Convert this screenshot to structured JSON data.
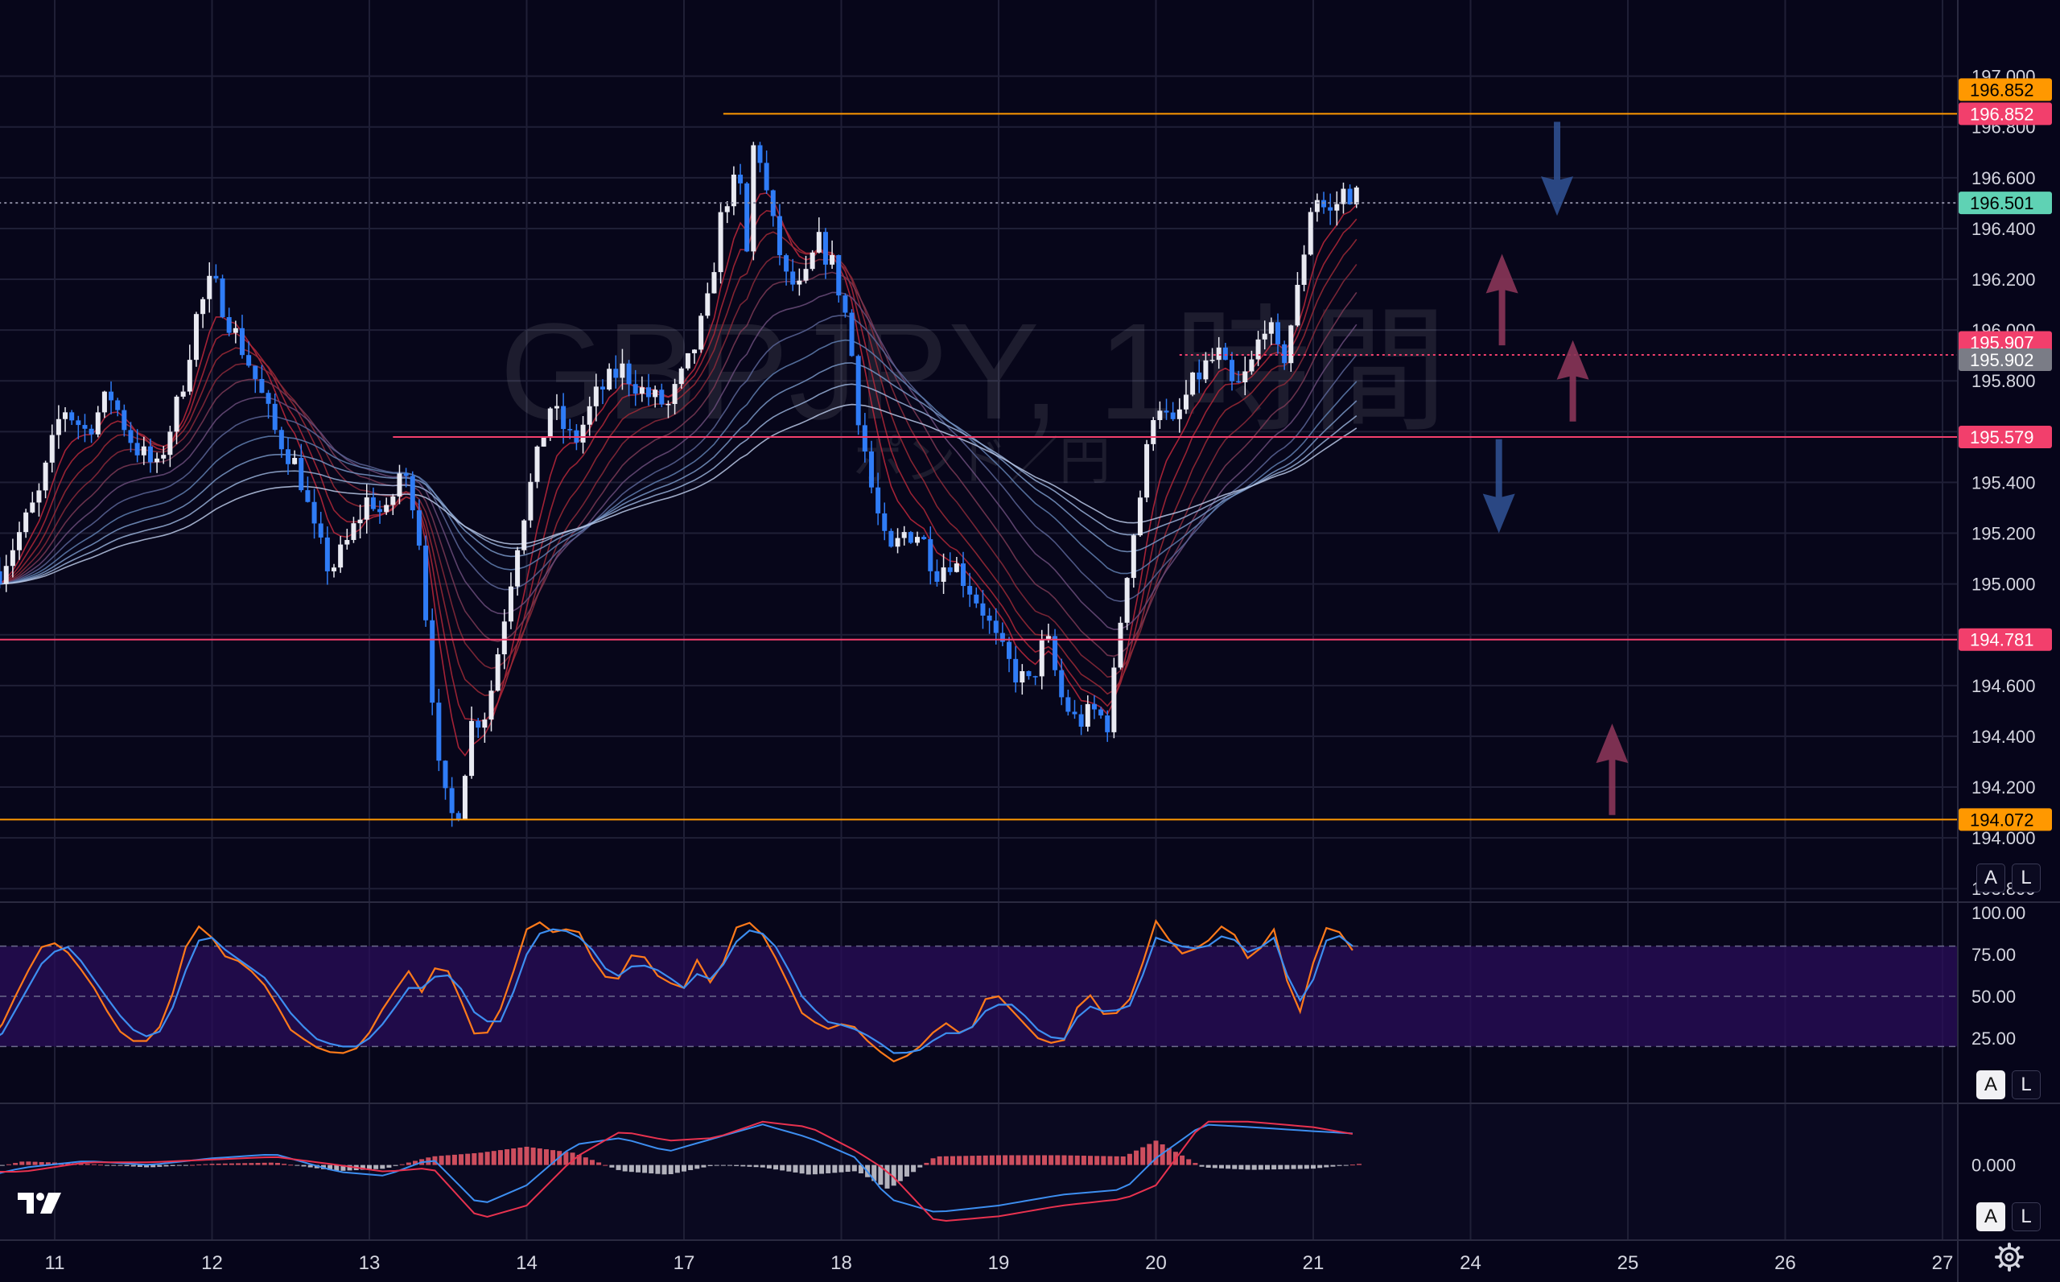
{
  "chart_data": {
    "type": "candlestick",
    "symbol": "GBPJPY, 1時間",
    "symbol_subtitle": "ポンド／円",
    "x_tick_labels": [
      "11",
      "12",
      "13",
      "14",
      "17",
      "18",
      "19",
      "20",
      "21",
      "24",
      "25",
      "26",
      "27"
    ],
    "price_axis": {
      "range": [
        193.75,
        197.3
      ],
      "tick_labels": [
        "197.000",
        "196.800",
        "196.600",
        "196.400",
        "196.200",
        "196.000",
        "195.800",
        "195.600",
        "195.400",
        "195.200",
        "195.000",
        "194.800",
        "194.600",
        "194.400",
        "194.200",
        "194.000",
        "193.800"
      ]
    },
    "price_tags": [
      {
        "label": "196.852",
        "price": 196.852,
        "color": "#ff9800",
        "text_color": "#000000"
      },
      {
        "label": "196.852",
        "price": 196.852,
        "color": "#f23f6c",
        "text_color": "#ffffff"
      },
      {
        "label": "196.501",
        "price": 196.501,
        "color": "#5fd2b4",
        "text_color": "#000000"
      },
      {
        "label": "195.907",
        "price": 195.907,
        "color": "#f23f6c",
        "text_color": "#ffffff"
      },
      {
        "label": "195.902",
        "price": 195.902,
        "color": "#7a7c86",
        "text_color": "#ffffff"
      },
      {
        "label": "195.579",
        "price": 195.579,
        "color": "#f23f6c",
        "text_color": "#ffffff"
      },
      {
        "label": "194.781",
        "price": 194.781,
        "color": "#f23f6c",
        "text_color": "#ffffff"
      },
      {
        "label": "194.072",
        "price": 194.072,
        "color": "#ff9800",
        "text_color": "#000000"
      }
    ],
    "horizontal_lines": [
      {
        "price": 196.852,
        "color": "#ff9800",
        "from_day": 4.25
      },
      {
        "price": 195.902,
        "color": "#f23f6c",
        "from_day": 7.15,
        "dotted": true
      },
      {
        "price": 195.579,
        "color": "#f23f6c",
        "from_day": 2.15
      },
      {
        "price": 194.781,
        "color": "#f23f6c",
        "from_day": -0.5
      },
      {
        "price": 194.072,
        "color": "#ff9800",
        "from_day": -0.5
      },
      {
        "price": 196.501,
        "color": "#8a8aa0",
        "from_day": -0.5,
        "dotted": true
      }
    ],
    "arrows": [
      {
        "direction": "down",
        "day": 9.55,
        "price_from": 196.82,
        "price_to": 196.45,
        "color": "#2f4f8f"
      },
      {
        "direction": "up",
        "day": 9.2,
        "price_from": 195.94,
        "price_to": 196.3,
        "color": "#8a3558"
      },
      {
        "direction": "up",
        "day": 9.65,
        "price_from": 195.64,
        "price_to": 195.96,
        "color": "#8a3558"
      },
      {
        "direction": "down",
        "day": 9.18,
        "price_from": 195.57,
        "price_to": 195.2,
        "color": "#2f4f8f"
      },
      {
        "direction": "up",
        "day": 9.9,
        "price_from": 194.09,
        "price_to": 194.45,
        "color": "#8a3558"
      }
    ],
    "price_anchors": [
      [
        -0.35,
        195.05
      ],
      [
        -0.1,
        195.35
      ],
      [
        0.05,
        195.7
      ],
      [
        0.2,
        195.6
      ],
      [
        0.35,
        195.75
      ],
      [
        0.5,
        195.55
      ],
      [
        0.65,
        195.45
      ],
      [
        0.8,
        195.75
      ],
      [
        0.9,
        196.05
      ],
      [
        1.0,
        196.2
      ],
      [
        1.1,
        196.05
      ],
      [
        1.25,
        195.85
      ],
      [
        1.4,
        195.6
      ],
      [
        1.55,
        195.45
      ],
      [
        1.65,
        195.2
      ],
      [
        1.75,
        195.05
      ],
      [
        1.85,
        195.15
      ],
      [
        2.0,
        195.35
      ],
      [
        2.1,
        195.25
      ],
      [
        2.2,
        195.45
      ],
      [
        2.3,
        195.3
      ],
      [
        2.37,
        194.8
      ],
      [
        2.45,
        194.2
      ],
      [
        2.55,
        194.05
      ],
      [
        2.65,
        194.45
      ],
      [
        2.75,
        194.5
      ],
      [
        2.85,
        194.85
      ],
      [
        2.95,
        195.2
      ],
      [
        3.05,
        195.45
      ],
      [
        3.15,
        195.7
      ],
      [
        3.3,
        195.55
      ],
      [
        3.45,
        195.75
      ],
      [
        3.6,
        195.85
      ],
      [
        3.75,
        195.75
      ],
      [
        3.9,
        195.7
      ],
      [
        4.05,
        195.9
      ],
      [
        4.15,
        196.1
      ],
      [
        4.25,
        196.5
      ],
      [
        4.35,
        196.6
      ],
      [
        4.4,
        196.3
      ],
      [
        4.45,
        196.8
      ],
      [
        4.55,
        196.45
      ],
      [
        4.65,
        196.2
      ],
      [
        4.75,
        196.15
      ],
      [
        4.85,
        196.35
      ],
      [
        4.95,
        196.25
      ],
      [
        5.05,
        196.0
      ],
      [
        5.1,
        195.7
      ],
      [
        5.2,
        195.35
      ],
      [
        5.3,
        195.1
      ],
      [
        5.4,
        195.2
      ],
      [
        5.5,
        195.2
      ],
      [
        5.6,
        195.05
      ],
      [
        5.7,
        195.1
      ],
      [
        5.8,
        195.0
      ],
      [
        5.9,
        194.9
      ],
      [
        6.0,
        194.75
      ],
      [
        6.1,
        194.65
      ],
      [
        6.2,
        194.6
      ],
      [
        6.3,
        194.8
      ],
      [
        6.4,
        194.55
      ],
      [
        6.5,
        194.45
      ],
      [
        6.6,
        194.5
      ],
      [
        6.7,
        194.45
      ],
      [
        6.8,
        195.0
      ],
      [
        6.9,
        195.35
      ],
      [
        7.0,
        195.75
      ],
      [
        7.1,
        195.6
      ],
      [
        7.2,
        195.75
      ],
      [
        7.3,
        195.85
      ],
      [
        7.4,
        195.9
      ],
      [
        7.5,
        195.75
      ],
      [
        7.6,
        195.85
      ],
      [
        7.7,
        196.05
      ],
      [
        7.8,
        195.85
      ],
      [
        7.9,
        196.15
      ],
      [
        8.0,
        196.55
      ],
      [
        8.1,
        196.45
      ],
      [
        8.2,
        196.55
      ],
      [
        8.3,
        196.52
      ]
    ],
    "stochastic": {
      "range": [
        0,
        100
      ],
      "tick_labels": [
        "100.00",
        "75.00",
        "50.00",
        "25.00"
      ],
      "levels": [
        80,
        50,
        20
      ],
      "band": [
        20,
        80
      ],
      "k_color": "#ff7a1a",
      "d_color": "#3d8ef0",
      "k_anchors": [
        [
          -0.5,
          15
        ],
        [
          -0.35,
          30
        ],
        [
          -0.2,
          60
        ],
        [
          -0.05,
          85
        ],
        [
          0.1,
          75
        ],
        [
          0.25,
          55
        ],
        [
          0.4,
          30
        ],
        [
          0.55,
          20
        ],
        [
          0.7,
          35
        ],
        [
          0.85,
          85
        ],
        [
          0.95,
          95
        ],
        [
          1.05,
          75
        ],
        [
          1.2,
          70
        ],
        [
          1.35,
          55
        ],
        [
          1.5,
          30
        ],
        [
          1.65,
          20
        ],
        [
          1.8,
          15
        ],
        [
          1.95,
          20
        ],
        [
          2.1,
          45
        ],
        [
          2.25,
          65
        ],
        [
          2.35,
          50
        ],
        [
          2.45,
          75
        ],
        [
          2.55,
          55
        ],
        [
          2.7,
          20
        ],
        [
          2.85,
          45
        ],
        [
          3.0,
          90
        ],
        [
          3.1,
          95
        ],
        [
          3.2,
          85
        ],
        [
          3.3,
          95
        ],
        [
          3.4,
          75
        ],
        [
          3.55,
          55
        ],
        [
          3.7,
          80
        ],
        [
          3.85,
          60
        ],
        [
          4.0,
          55
        ],
        [
          4.1,
          75
        ],
        [
          4.2,
          50
        ],
        [
          4.3,
          90
        ],
        [
          4.45,
          95
        ],
        [
          4.6,
          70
        ],
        [
          4.75,
          40
        ],
        [
          4.9,
          30
        ],
        [
          5.05,
          35
        ],
        [
          5.2,
          20
        ],
        [
          5.35,
          10
        ],
        [
          5.5,
          20
        ],
        [
          5.65,
          35
        ],
        [
          5.8,
          25
        ],
        [
          5.95,
          55
        ],
        [
          6.1,
          40
        ],
        [
          6.25,
          25
        ],
        [
          6.4,
          20
        ],
        [
          6.55,
          55
        ],
        [
          6.7,
          35
        ],
        [
          6.85,
          50
        ],
        [
          7.0,
          95
        ],
        [
          7.15,
          75
        ],
        [
          7.3,
          80
        ],
        [
          7.45,
          95
        ],
        [
          7.6,
          70
        ],
        [
          7.75,
          90
        ],
        [
          7.9,
          35
        ],
        [
          8.0,
          70
        ],
        [
          8.1,
          95
        ],
        [
          8.2,
          85
        ],
        [
          8.3,
          70
        ]
      ],
      "d_anchors": [
        [
          -0.5,
          20
        ],
        [
          -0.35,
          25
        ],
        [
          -0.2,
          50
        ],
        [
          -0.05,
          75
        ],
        [
          0.1,
          80
        ],
        [
          0.25,
          60
        ],
        [
          0.4,
          40
        ],
        [
          0.55,
          25
        ],
        [
          0.7,
          30
        ],
        [
          0.85,
          70
        ],
        [
          0.95,
          90
        ],
        [
          1.05,
          80
        ],
        [
          1.2,
          70
        ],
        [
          1.35,
          60
        ],
        [
          1.5,
          40
        ],
        [
          1.65,
          25
        ],
        [
          1.8,
          20
        ],
        [
          1.95,
          20
        ],
        [
          2.1,
          35
        ],
        [
          2.25,
          55
        ],
        [
          2.35,
          55
        ],
        [
          2.45,
          65
        ],
        [
          2.55,
          60
        ],
        [
          2.7,
          35
        ],
        [
          2.85,
          35
        ],
        [
          3.0,
          75
        ],
        [
          3.1,
          90
        ],
        [
          3.2,
          90
        ],
        [
          3.3,
          88
        ],
        [
          3.4,
          80
        ],
        [
          3.55,
          60
        ],
        [
          3.7,
          70
        ],
        [
          3.85,
          65
        ],
        [
          4.0,
          55
        ],
        [
          4.1,
          65
        ],
        [
          4.2,
          58
        ],
        [
          4.3,
          80
        ],
        [
          4.45,
          92
        ],
        [
          4.6,
          78
        ],
        [
          4.75,
          50
        ],
        [
          4.9,
          35
        ],
        [
          5.05,
          32
        ],
        [
          5.2,
          25
        ],
        [
          5.35,
          15
        ],
        [
          5.5,
          18
        ],
        [
          5.65,
          28
        ],
        [
          5.8,
          28
        ],
        [
          5.95,
          45
        ],
        [
          6.1,
          45
        ],
        [
          6.25,
          30
        ],
        [
          6.4,
          22
        ],
        [
          6.55,
          45
        ],
        [
          6.7,
          40
        ],
        [
          6.85,
          45
        ],
        [
          7.0,
          85
        ],
        [
          7.15,
          80
        ],
        [
          7.3,
          78
        ],
        [
          7.45,
          88
        ],
        [
          7.6,
          75
        ],
        [
          7.75,
          85
        ],
        [
          7.9,
          45
        ],
        [
          8.0,
          60
        ],
        [
          8.1,
          88
        ],
        [
          8.2,
          85
        ],
        [
          8.3,
          75
        ]
      ]
    },
    "macd": {
      "tick_labels": [
        "0.000"
      ],
      "zero_value": 0,
      "range": [
        -0.55,
        0.45
      ],
      "macd_color": "#3d8ef0",
      "signal_color": "#e8324f",
      "hist_pos_color": "#f05a6a",
      "hist_neg_color": "#d0d0d8",
      "macd_anchors": [
        [
          -0.5,
          -0.1
        ],
        [
          -0.2,
          -0.02
        ],
        [
          0.2,
          0.03
        ],
        [
          0.6,
          0.0
        ],
        [
          1.0,
          0.05
        ],
        [
          1.4,
          0.08
        ],
        [
          1.8,
          -0.05
        ],
        [
          2.1,
          -0.08
        ],
        [
          2.4,
          0.05
        ],
        [
          2.7,
          -0.3
        ],
        [
          3.0,
          -0.15
        ],
        [
          3.3,
          0.15
        ],
        [
          3.6,
          0.2
        ],
        [
          3.9,
          0.1
        ],
        [
          4.2,
          0.2
        ],
        [
          4.5,
          0.3
        ],
        [
          4.8,
          0.2
        ],
        [
          5.1,
          0.05
        ],
        [
          5.3,
          -0.25
        ],
        [
          5.6,
          -0.35
        ],
        [
          6.0,
          -0.3
        ],
        [
          6.4,
          -0.22
        ],
        [
          6.8,
          -0.18
        ],
        [
          7.0,
          0.05
        ],
        [
          7.3,
          0.3
        ],
        [
          7.6,
          0.28
        ],
        [
          8.0,
          0.25
        ],
        [
          8.3,
          0.23
        ]
      ],
      "signal_anchors": [
        [
          -0.5,
          -0.05
        ],
        [
          -0.2,
          -0.05
        ],
        [
          0.2,
          0.02
        ],
        [
          0.6,
          0.02
        ],
        [
          1.0,
          0.04
        ],
        [
          1.4,
          0.06
        ],
        [
          1.8,
          0.0
        ],
        [
          2.1,
          -0.05
        ],
        [
          2.4,
          -0.02
        ],
        [
          2.7,
          -0.4
        ],
        [
          3.0,
          -0.3
        ],
        [
          3.3,
          0.05
        ],
        [
          3.6,
          0.25
        ],
        [
          3.9,
          0.18
        ],
        [
          4.2,
          0.2
        ],
        [
          4.5,
          0.32
        ],
        [
          4.8,
          0.28
        ],
        [
          5.1,
          0.1
        ],
        [
          5.3,
          -0.05
        ],
        [
          5.6,
          -0.42
        ],
        [
          6.0,
          -0.38
        ],
        [
          6.4,
          -0.3
        ],
        [
          6.8,
          -0.25
        ],
        [
          7.0,
          -0.15
        ],
        [
          7.3,
          0.32
        ],
        [
          7.6,
          0.32
        ],
        [
          8.0,
          0.28
        ],
        [
          8.3,
          0.22
        ]
      ]
    },
    "last_day": 8.3
  },
  "buttons": {
    "auto": "A",
    "log": "L"
  },
  "icons": {
    "logo": "tradingview-logo",
    "settings": "gear-icon"
  }
}
